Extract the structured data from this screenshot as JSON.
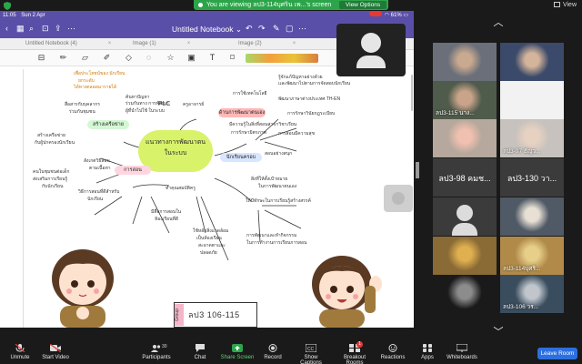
{
  "zoom": {
    "share_banner": "You are viewing ลป3-114บุศริน เพ...'s screen",
    "view_options": "View Options",
    "view_label": "View"
  },
  "ipad": {
    "status_time": "11:05",
    "status_date": "Sun 2 Apr",
    "battery": "61%",
    "app_title": "Untitled Notebook",
    "tabs": [
      "Untitled Notebook (4)",
      "Image (1)",
      "Image (2)"
    ]
  },
  "mindmap": {
    "center": "แนวทางการพัฒนาตน ในระบบ",
    "plc": "PLC",
    "group_label": "Group",
    "group_text": "ลป3 106-115",
    "branches": [
      {
        "label": "สร้างเครือข่าย"
      },
      {
        "label": "สร้างความมั่นใจ"
      },
      {
        "label": "การสอน"
      },
      {
        "label": "นักเรียนครอบ"
      },
      {
        "label": "ด้านการพัฒนาตนเอง"
      }
    ],
    "notes": [
      "เพื่อประโยชน์ของ นักเรียน",
      "ยกระดับ",
      "ได้ทางตลอดมารายได้",
      "สื่อสารกับบุคลากร",
      "ร่วมกันชุมชน",
      "สร้างเครือข่าย",
      "กับผู้ปกครองนักเรียน",
      "ค้นหาปัญหา",
      "ร่วมกันทาง การพัฒนา",
      "ผู้ที่นำไปใช้ ในระบบ",
      "ครูอาจารย์",
      "รู้จักแก้ปัญหาอย่างด้วย",
      "และพัฒนาไปตามการจัดสอบนักเรียน",
      "การใช้เทคโนโลยี",
      "พัฒนาภาษาต่างประเทศ TH-EN",
      "การรักษาวินัยกฎระเบียบ",
      "มีความรู้ในสิ่งที่สอนสาขาวิชาเรียน",
      "การรักษามิตรภาพ",
      "การสอนมีความสุข",
      "สอนอย่างสนุก",
      "คนในชุมชนต่อเด็ก",
      "ส่งเสริมการเรียนรู้",
      "กับนักเรียน",
      "สิ่งที่ให้ตั้งเป้าหมาย",
      "ในการพัฒนาตนเอง",
      "ให้มีทักษะในการเรียนรู้สร้างสรรค์",
      "การพัฒนาและทำกิจกรรม",
      "ในการทำงานการเรียนการสอน",
      "สังเกตวิธีสอน",
      "ตามเนื้อหา",
      "วิธีการสอนที่ดีสำหรับ",
      "นักเรียน",
      "ทำคุณสมบัติครู",
      "มีสื่อการสอนใน",
      "ห้องเรียนที่ดี",
      "ใช้หลักสิ่งแวดล้อม",
      "เป็นห้องเรียน",
      "สะอาดตาและ",
      "ปลอดภัย"
    ]
  },
  "gallery": {
    "participants": [
      {
        "name": "",
        "kind": "video"
      },
      {
        "name": "",
        "kind": "video"
      },
      {
        "name": "ลป3-115 นาง...",
        "kind": "video"
      },
      {
        "name": "",
        "kind": "blank"
      },
      {
        "name": "",
        "kind": "video"
      },
      {
        "name": "ลป3-97 ธัญว...",
        "kind": "video"
      },
      {
        "name": "ลป3-98 คมช...",
        "kind": "name"
      },
      {
        "name": "ลป3-130 วา...",
        "kind": "name"
      },
      {
        "name": "",
        "kind": "avatar"
      },
      {
        "name": "",
        "kind": "video"
      },
      {
        "name": "",
        "kind": "video"
      },
      {
        "name": "ลป3-114บุศริ...",
        "kind": "video"
      },
      {
        "name": "",
        "kind": "video"
      },
      {
        "name": "ลป3-106 วร...",
        "kind": "video"
      }
    ]
  },
  "toolbar": {
    "unmute": "Unmute",
    "start_video": "Start Video",
    "participants": "Participants",
    "participant_count": "30",
    "chat": "Chat",
    "share_screen": "Share Screen",
    "record": "Record",
    "show_captions": "Show Captions",
    "breakout_rooms": "Breakout Rooms",
    "reactions": "Reactions",
    "apps": "Apps",
    "whiteboards": "Whiteboards",
    "leave": "Leave Room",
    "breakout_badge": "1"
  },
  "colors": {
    "share_green": "#2ca54a",
    "leave_blue": "#2d6fe0",
    "active_speaker": "#8fd24a",
    "goodnotes_purple": "#5a4fa8",
    "center_cloud": "#d8f26a"
  }
}
